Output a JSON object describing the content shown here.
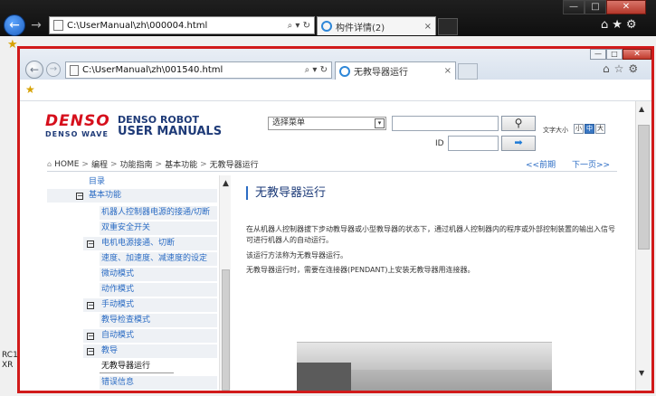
{
  "outer": {
    "url": "C:\\UserManual\\zh\\000004.html",
    "addr_tools": "⌕ ▾ ↻",
    "tab_label": "构件详情(2)",
    "tab_close": "×",
    "back_glyph": "←",
    "forward_glyph": "→",
    "win_min": "—",
    "win_max": "□",
    "win_close": "✕",
    "tools": "⌂★⚙",
    "fav_star": "★",
    "side_text_1": "RC1",
    "side_text_2": "XR"
  },
  "inner": {
    "url": "C:\\UserManual\\zh\\001540.html",
    "addr_tools": "⌕ ▾ ↻",
    "tab_label": "无教导器运行",
    "tab_close": "×",
    "back_glyph": "←",
    "forward_glyph": "→",
    "win_min": "—",
    "win_max": "□",
    "win_close": "✕",
    "tools": "⌂☆⚙",
    "fav_star": "★"
  },
  "header": {
    "logo_main": "DENSO",
    "logo_sub": "DENSO WAVE",
    "product_line1": "DENSO ROBOT",
    "product_line2": "USER MANUALS",
    "menu_select_value": "选择菜单",
    "menu_select_dd": "▾",
    "search_glyph": "⚲",
    "id_label": "ID",
    "go_glyph": "➡",
    "font_size_label": "文字大小",
    "fs_small": "小",
    "fs_mid": "中",
    "fs_large": "大"
  },
  "breadcrumb": {
    "home_icon": "⌂",
    "items": [
      "HOME",
      "编程",
      "功能指南",
      "基本功能",
      "无教导器运行"
    ],
    "separator": ">",
    "prev": "<<前期",
    "next": "下一页>>"
  },
  "toc": {
    "up_glyph": "▲",
    "collapse_glyph": "−",
    "rows": [
      {
        "label": "目录",
        "type": "item"
      },
      {
        "label": "基本功能",
        "type": "section"
      },
      {
        "label": "机器人控制器电源的接通/切断",
        "type": "item"
      },
      {
        "label": "双重安全开关",
        "type": "item"
      },
      {
        "label": "电机电源接通、切断",
        "type": "section"
      },
      {
        "label": "速度、加速度、减速度的设定",
        "type": "item"
      },
      {
        "label": "微动模式",
        "type": "item"
      },
      {
        "label": "动作模式",
        "type": "item"
      },
      {
        "label": "手动模式",
        "type": "section"
      },
      {
        "label": "教导检查模式",
        "type": "item"
      },
      {
        "label": "自动模式",
        "type": "section"
      },
      {
        "label": "教导",
        "type": "section"
      },
      {
        "label": "无教导器运行",
        "type": "selected"
      },
      {
        "label": "错误信息",
        "type": "item"
      }
    ]
  },
  "article": {
    "title": "无教导器运行",
    "para1": "在从机器人控制器拔下步动教导器或小型教导器的状态下，通过机器人控制器内的程序或外部控制装置的输出入信号可进行机器人的自动运行。",
    "para2": "该运行方法称为无教导器运行。",
    "para3": "无教导器运行时，需要在连接器(PENDANT)上安装无教导器用连接器。"
  },
  "page_scroll": {
    "up_glyph": "▲",
    "down_glyph": "▼"
  }
}
